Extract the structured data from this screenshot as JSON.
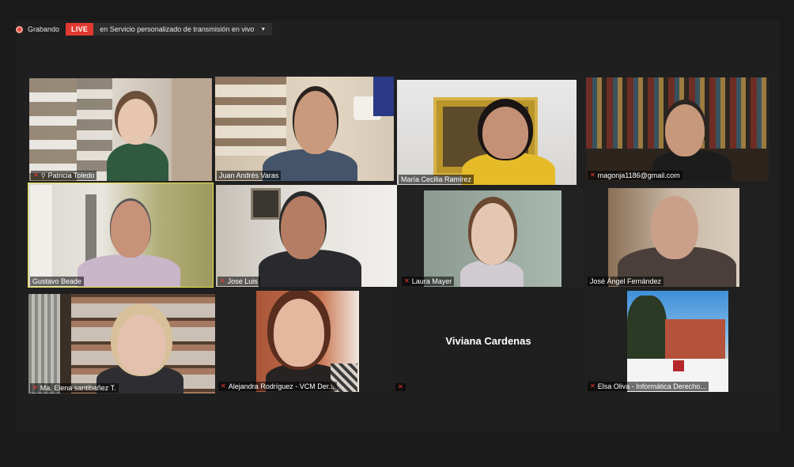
{
  "topbar": {
    "recording_label": "Grabando",
    "live_label": "LIVE",
    "stream_label": "en Servicio personalizado de transmisión en vivo"
  },
  "participants": [
    {
      "name": "Patricia Toledo",
      "muted": true,
      "pinned": true
    },
    {
      "name": "Juan Andrés Varas",
      "muted": false
    },
    {
      "name": "María Cecilia Ramírez",
      "muted": false
    },
    {
      "name": "magonja1186@gmail.com",
      "muted": true
    },
    {
      "name": "Gustavo Beade",
      "muted": false,
      "active_speaker": true
    },
    {
      "name": "Jose Luis",
      "muted": true
    },
    {
      "name": "Laura Mayer",
      "muted": true
    },
    {
      "name": "José Ángel Fernández",
      "muted": false
    },
    {
      "name": "Ma. Elena santibañez T.",
      "muted": true
    },
    {
      "name": "Alejandra Rodríguez - VCM Der...",
      "muted": true
    },
    {
      "name": "Viviana Cardenas",
      "muted": true,
      "video_off": true
    },
    {
      "name": "Elsa Oliva - Informática Derecho...",
      "muted": true
    }
  ],
  "colors": {
    "live": "#e03a30",
    "active_border": "#e8e24a",
    "muted_icon": "#ff3b30"
  }
}
